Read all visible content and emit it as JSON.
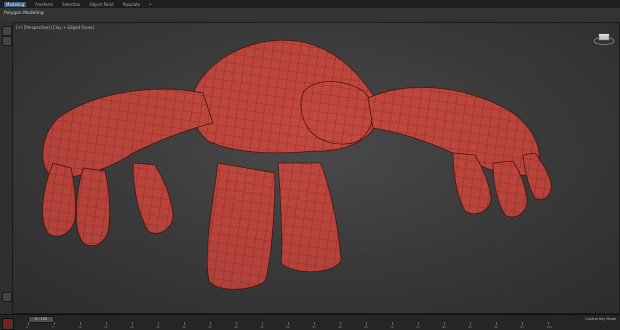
{
  "menubar": {
    "items": [
      {
        "label": "Modeling",
        "active": true
      },
      {
        "label": "Freeform"
      },
      {
        "label": "Selection"
      },
      {
        "label": "Object Paint"
      },
      {
        "label": "Populate"
      },
      {
        "label": "•"
      }
    ]
  },
  "ribbon": {
    "label": "Polygon Modeling"
  },
  "viewport": {
    "label": "[+] [Perspective] [Clay + Edged Faces]"
  },
  "timeline": {
    "slider": "0 / 100",
    "ticks": [
      "0",
      "5",
      "10",
      "15",
      "20",
      "25",
      "30",
      "35",
      "40",
      "45",
      "50",
      "55",
      "60",
      "65",
      "70",
      "75",
      "80",
      "85",
      "90",
      "95",
      "100"
    ],
    "status_right": "Control Key Mode"
  },
  "colors": {
    "model_fill": "#c4483f",
    "model_wire": "#5a1e1a",
    "background": "#3f3f3f"
  }
}
